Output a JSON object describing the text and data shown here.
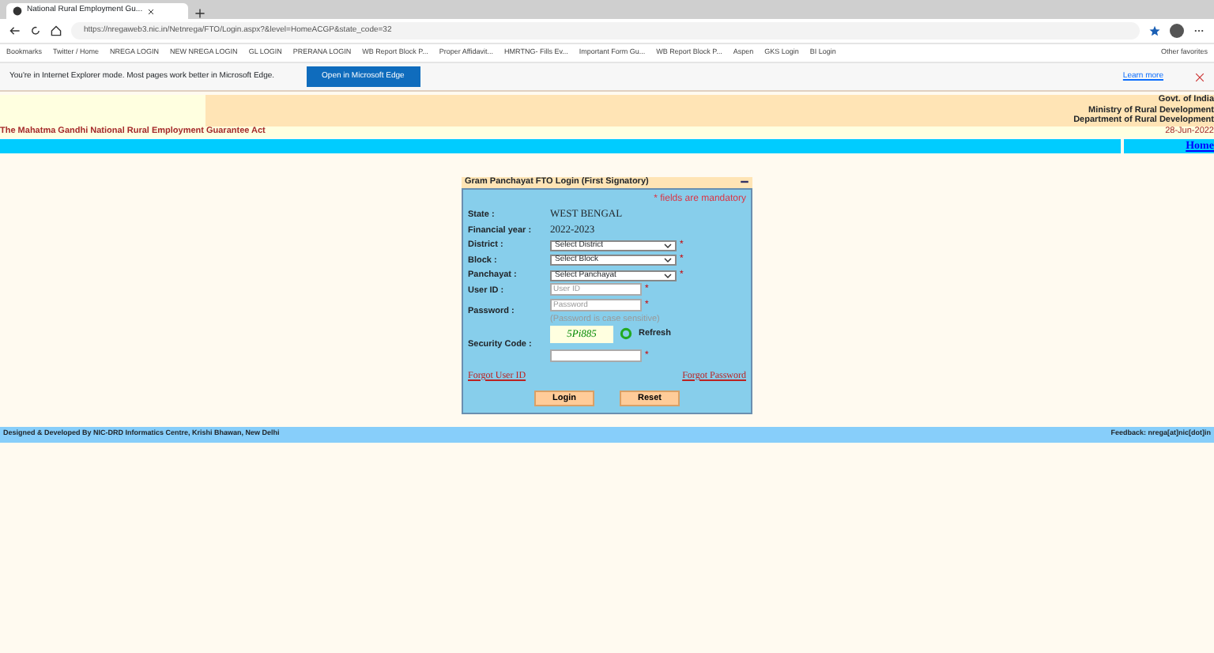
{
  "browser": {
    "tab_title": "National Rural Employment Gu...",
    "address": "https://nregaweb3.nic.in/Netnrega/FTO/Login.aspx?&level=HomeACGP&state_code=32",
    "bookmarks": [
      "Bookmarks",
      "Twitter / Home",
      "NREGA LOGIN",
      "NEW NREGA LOGIN",
      "GL LOGIN",
      "PRERANA LOGIN",
      "WB Report Block P...",
      "Proper Affidavit...",
      "HMRTNG- Fills Ev...",
      "Important Form Gu...",
      "WB Report Block P...",
      "Aspen",
      "GKS Login",
      "BI Login"
    ],
    "other_favorites": "Other favorites",
    "ie_banner": {
      "message": "You're in Internet Explorer mode. Most pages work better in Microsoft Edge.",
      "button": "Open in Microsoft Edge",
      "link": "Learn more"
    }
  },
  "header": {
    "lines": [
      "Govt. of India",
      "Ministry of Rural Development",
      "Department of Rural Development"
    ],
    "act": "The Mahatma Gandhi National Rural Employment Guarantee Act",
    "date": "28-Jun-2022",
    "home": "Home"
  },
  "login": {
    "title": "Gram Panchayat FTO Login (First Signatory)",
    "mandatory_note": "* fields are mandatory",
    "fields": [
      {
        "kind": "text",
        "label": "State :",
        "value": "WEST BENGAL"
      },
      {
        "kind": "text",
        "label": "Financial year :",
        "value": "2022-2023"
      },
      {
        "kind": "select",
        "label": "District :",
        "value": "Select District",
        "required_mark": "*"
      },
      {
        "kind": "select",
        "label": "Block :",
        "value": "Select Block",
        "required_mark": "*"
      },
      {
        "kind": "select",
        "label": "Panchayat :",
        "value": "Select Panchayat",
        "required_mark": "*"
      },
      {
        "kind": "input",
        "label": "User ID :",
        "placeholder": "User ID",
        "required_mark": "*"
      },
      {
        "kind": "password",
        "label": "Password :",
        "placeholder": "Password",
        "required_mark": "*",
        "hint": "(Password is case sensitive)"
      },
      {
        "kind": "captcha",
        "label": "Security Code :",
        "captcha": "5Pi885",
        "refresh": "Refresh",
        "required_mark": "*"
      }
    ],
    "forgot_user": "Forgot User ID",
    "forgot_password": "Forgot Password",
    "buttons": [
      "Login",
      "Reset"
    ]
  },
  "footer": {
    "left": "Designed & Developed By NIC-DRD Informatics Centre, Krishi Bhawan, New Delhi",
    "right": "Feedback: nrega[at]nic[dot]in"
  }
}
